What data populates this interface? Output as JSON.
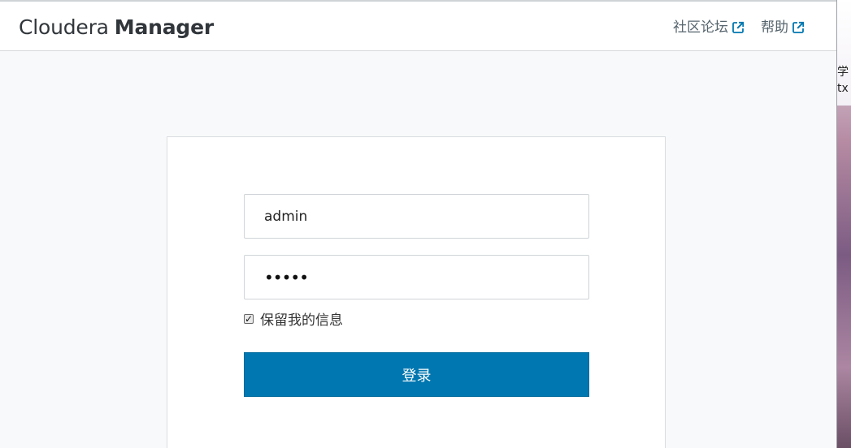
{
  "header": {
    "brand_prefix": "Cloudera",
    "brand_suffix": "Manager",
    "links": [
      {
        "label": "社区论坛",
        "icon": "external-link-icon"
      },
      {
        "label": "帮助",
        "icon": "external-link-icon"
      }
    ]
  },
  "login": {
    "username_value": "admin",
    "password_mask": "•••••",
    "remember_checked": "✓",
    "remember_label": "保留我的信息",
    "submit_label": "登录"
  },
  "desktop": {
    "partial_label_line1": "学",
    "partial_label_line2": "tx"
  },
  "colors": {
    "accent": "#0077b0",
    "nav_text": "#56646d",
    "page_background": "#f8f9fa"
  }
}
